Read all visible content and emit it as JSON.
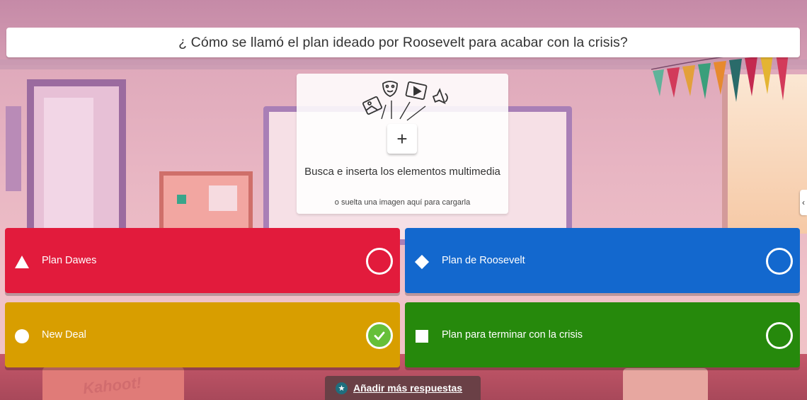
{
  "question": {
    "text": "¿ Cómo se llamó el plan ideado por Roosevelt para acabar con la crisis?"
  },
  "media": {
    "add_button_label": "+",
    "title": "Busca e inserta los elementos multimedia",
    "hint": "o suelta una imagen aquí para cargarla",
    "illustration_icons": [
      "image-icon",
      "mask-icon",
      "video-icon",
      "audio-icon"
    ]
  },
  "answers": [
    {
      "label": "Plan Dawes",
      "color": "#e21b3c",
      "shape": "triangle-icon",
      "correct": false
    },
    {
      "label": "Plan de Roosevelt",
      "color": "#1368ce",
      "shape": "diamond-icon",
      "correct": false
    },
    {
      "label": "New Deal",
      "color": "#d89e00",
      "shape": "circle-icon",
      "correct": true
    },
    {
      "label": "Plan para terminar con la crisis",
      "color": "#26890c",
      "shape": "square-icon",
      "correct": false
    }
  ],
  "add_more": {
    "label": "Añadir más respuestas",
    "icon": "star-icon"
  },
  "background": {
    "logo_text": "Kahoot!"
  },
  "side_tab": {
    "icon": "chevron-left-icon",
    "glyph": "‹"
  },
  "colors": {
    "correct_check": "#66bf39",
    "add_more_bg": "#6a4046"
  }
}
